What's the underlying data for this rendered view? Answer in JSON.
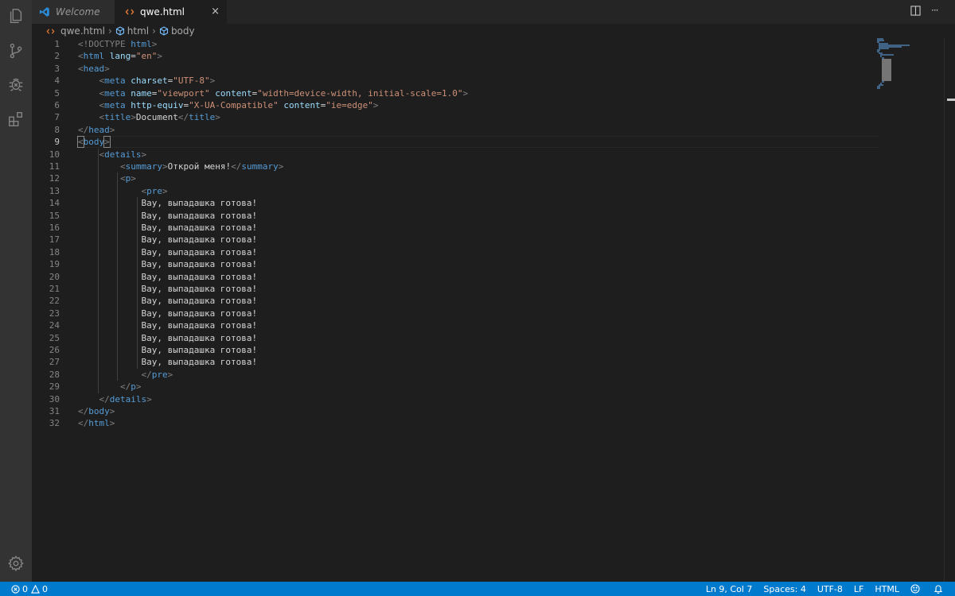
{
  "tabs": [
    {
      "label": "Welcome",
      "active": false,
      "icon": "vscode-logo-icon"
    },
    {
      "label": "qwe.html",
      "active": true,
      "icon": "html-file-icon",
      "close": "×"
    }
  ],
  "tab_actions": {
    "more": "···"
  },
  "breadcrumb": {
    "file": "qwe.html",
    "items": [
      "html",
      "body"
    ]
  },
  "editor": {
    "active_line": 9,
    "line_numbers": [
      "1",
      "2",
      "3",
      "4",
      "5",
      "6",
      "7",
      "8",
      "9",
      "10",
      "11",
      "12",
      "13",
      "14",
      "15",
      "16",
      "17",
      "18",
      "19",
      "20",
      "21",
      "22",
      "23",
      "24",
      "25",
      "26",
      "27",
      "28",
      "29",
      "30",
      "31",
      "32"
    ],
    "lines": [
      [
        {
          "t": "<!DOCTYPE ",
          "c": "brk"
        },
        {
          "t": "html",
          "c": "tag"
        },
        {
          "t": ">",
          "c": "brk"
        }
      ],
      [
        {
          "t": "<",
          "c": "brk"
        },
        {
          "t": "html",
          "c": "tag"
        },
        {
          "t": " lang",
          "c": "attr"
        },
        {
          "t": "=",
          "c": "txt"
        },
        {
          "t": "\"en\"",
          "c": "str"
        },
        {
          "t": ">",
          "c": "brk"
        }
      ],
      [
        {
          "t": "<",
          "c": "brk"
        },
        {
          "t": "head",
          "c": "tag"
        },
        {
          "t": ">",
          "c": "brk"
        }
      ],
      [
        {
          "t": "    ",
          "c": "txt"
        },
        {
          "t": "<",
          "c": "brk"
        },
        {
          "t": "meta",
          "c": "tag"
        },
        {
          "t": " charset",
          "c": "attr"
        },
        {
          "t": "=",
          "c": "txt"
        },
        {
          "t": "\"UTF-8\"",
          "c": "str"
        },
        {
          "t": ">",
          "c": "brk"
        }
      ],
      [
        {
          "t": "    ",
          "c": "txt"
        },
        {
          "t": "<",
          "c": "brk"
        },
        {
          "t": "meta",
          "c": "tag"
        },
        {
          "t": " name",
          "c": "attr"
        },
        {
          "t": "=",
          "c": "txt"
        },
        {
          "t": "\"viewport\"",
          "c": "str"
        },
        {
          "t": " content",
          "c": "attr"
        },
        {
          "t": "=",
          "c": "txt"
        },
        {
          "t": "\"width=device-width, initial-scale=1.0\"",
          "c": "str"
        },
        {
          "t": ">",
          "c": "brk"
        }
      ],
      [
        {
          "t": "    ",
          "c": "txt"
        },
        {
          "t": "<",
          "c": "brk"
        },
        {
          "t": "meta",
          "c": "tag"
        },
        {
          "t": " http-equiv",
          "c": "attr"
        },
        {
          "t": "=",
          "c": "txt"
        },
        {
          "t": "\"X-UA-Compatible\"",
          "c": "str"
        },
        {
          "t": " content",
          "c": "attr"
        },
        {
          "t": "=",
          "c": "txt"
        },
        {
          "t": "\"ie=edge\"",
          "c": "str"
        },
        {
          "t": ">",
          "c": "brk"
        }
      ],
      [
        {
          "t": "    ",
          "c": "txt"
        },
        {
          "t": "<",
          "c": "brk"
        },
        {
          "t": "title",
          "c": "tag"
        },
        {
          "t": ">",
          "c": "brk"
        },
        {
          "t": "Document",
          "c": "txt"
        },
        {
          "t": "</",
          "c": "brk"
        },
        {
          "t": "title",
          "c": "tag"
        },
        {
          "t": ">",
          "c": "brk"
        }
      ],
      [
        {
          "t": "</",
          "c": "brk"
        },
        {
          "t": "head",
          "c": "tag"
        },
        {
          "t": ">",
          "c": "brk"
        }
      ],
      [
        {
          "t": "<",
          "c": "brk",
          "bm": true
        },
        {
          "t": "body",
          "c": "tag"
        },
        {
          "t": ">",
          "c": "brk",
          "bm": true
        }
      ],
      [
        {
          "t": "    ",
          "c": "txt"
        },
        {
          "t": "<",
          "c": "brk"
        },
        {
          "t": "details",
          "c": "tag"
        },
        {
          "t": ">",
          "c": "brk"
        }
      ],
      [
        {
          "t": "        ",
          "c": "txt"
        },
        {
          "t": "<",
          "c": "brk"
        },
        {
          "t": "summary",
          "c": "tag"
        },
        {
          "t": ">",
          "c": "brk"
        },
        {
          "t": "Открой меня!",
          "c": "txt"
        },
        {
          "t": "</",
          "c": "brk"
        },
        {
          "t": "summary",
          "c": "tag"
        },
        {
          "t": ">",
          "c": "brk"
        }
      ],
      [
        {
          "t": "        ",
          "c": "txt"
        },
        {
          "t": "<",
          "c": "brk"
        },
        {
          "t": "p",
          "c": "tag"
        },
        {
          "t": ">",
          "c": "brk"
        }
      ],
      [
        {
          "t": "            ",
          "c": "txt"
        },
        {
          "t": "<",
          "c": "brk"
        },
        {
          "t": "pre",
          "c": "tag"
        },
        {
          "t": ">",
          "c": "brk"
        }
      ],
      [
        {
          "t": "            Вау, выпадашка готова!",
          "c": "txt"
        }
      ],
      [
        {
          "t": "            Вау, выпадашка готова!",
          "c": "txt"
        }
      ],
      [
        {
          "t": "            Вау, выпадашка готова!",
          "c": "txt"
        }
      ],
      [
        {
          "t": "            Вау, выпадашка готова!",
          "c": "txt"
        }
      ],
      [
        {
          "t": "            Вау, выпадашка готова!",
          "c": "txt"
        }
      ],
      [
        {
          "t": "            Вау, выпадашка готова!",
          "c": "txt"
        }
      ],
      [
        {
          "t": "            Вау, выпадашка готова!",
          "c": "txt"
        }
      ],
      [
        {
          "t": "            Вау, выпадашка готова!",
          "c": "txt"
        }
      ],
      [
        {
          "t": "            Вау, выпадашка готова!",
          "c": "txt"
        }
      ],
      [
        {
          "t": "            Вау, выпадашка готова!",
          "c": "txt"
        }
      ],
      [
        {
          "t": "            Вау, выпадашка готова!",
          "c": "txt"
        }
      ],
      [
        {
          "t": "            Вау, выпадашка готова!",
          "c": "txt"
        }
      ],
      [
        {
          "t": "            Вау, выпадашка готова!",
          "c": "txt"
        }
      ],
      [
        {
          "t": "            Вау, выпадашка готова!",
          "c": "txt"
        }
      ],
      [
        {
          "t": "            ",
          "c": "txt"
        },
        {
          "t": "</",
          "c": "brk"
        },
        {
          "t": "pre",
          "c": "tag"
        },
        {
          "t": ">",
          "c": "brk"
        }
      ],
      [
        {
          "t": "        ",
          "c": "txt"
        },
        {
          "t": "</",
          "c": "brk"
        },
        {
          "t": "p",
          "c": "tag"
        },
        {
          "t": ">",
          "c": "brk"
        }
      ],
      [
        {
          "t": "    ",
          "c": "txt"
        },
        {
          "t": "</",
          "c": "brk"
        },
        {
          "t": "details",
          "c": "tag"
        },
        {
          "t": ">",
          "c": "brk"
        }
      ],
      [
        {
          "t": "</",
          "c": "brk"
        },
        {
          "t": "body",
          "c": "tag"
        },
        {
          "t": ">",
          "c": "brk"
        }
      ],
      [
        {
          "t": "</",
          "c": "brk"
        },
        {
          "t": "html",
          "c": "tag"
        },
        {
          "t": ">",
          "c": "brk"
        }
      ]
    ]
  },
  "status": {
    "errors": "0",
    "warnings": "0",
    "position": "Ln 9, Col 7",
    "indent": "Spaces: 4",
    "encoding": "UTF-8",
    "eol": "LF",
    "language": "HTML"
  },
  "colors": {
    "statusbar": "#007acc",
    "tag": "#569cd6",
    "attr": "#9cdcfe",
    "string": "#ce9178",
    "bracket": "#808080",
    "html_icon": "#e37933"
  }
}
